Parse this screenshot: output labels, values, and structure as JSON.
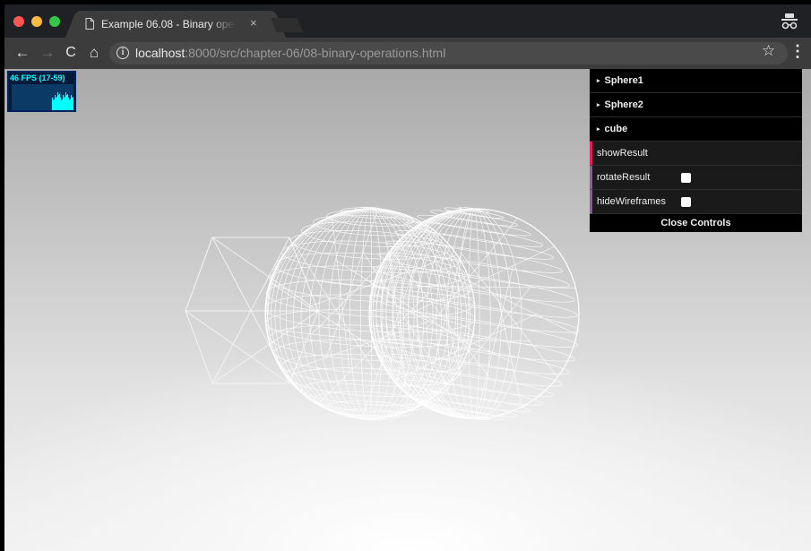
{
  "browser": {
    "tab_title": "Example 06.08 - Binary operations",
    "tab_close": "×",
    "url_host": "localhost",
    "url_rest": ":8000/src/chapter-06/08-binary-operations.html",
    "icons": {
      "back": "arrow-left-icon",
      "forward": "arrow-right-icon",
      "reload": "reload-icon",
      "home": "home-icon",
      "info": "info-icon",
      "bookmark": "star-icon",
      "menu": "more-vert-icon",
      "incognito": "incognito-icon"
    },
    "glyphs": {
      "back": "←",
      "forward": "→",
      "reload": "C",
      "home": "⌂",
      "info": "i",
      "bookmark": "☆",
      "menu": "⋮"
    }
  },
  "stats": {
    "fps_text": "46 FPS (17-59)",
    "color": "#00ffff"
  },
  "gui": {
    "folders": [
      "Sphere1",
      "Sphere2",
      "cube"
    ],
    "show_result": "showResult",
    "rotate_result": {
      "label": "rotateResult",
      "checked": false
    },
    "hide_wireframes": {
      "label": "hideWireframes",
      "checked": false
    },
    "close_label": "Close Controls",
    "colors": {
      "function_accent": "#e61d5f",
      "boolean_accent": "#806787"
    }
  }
}
